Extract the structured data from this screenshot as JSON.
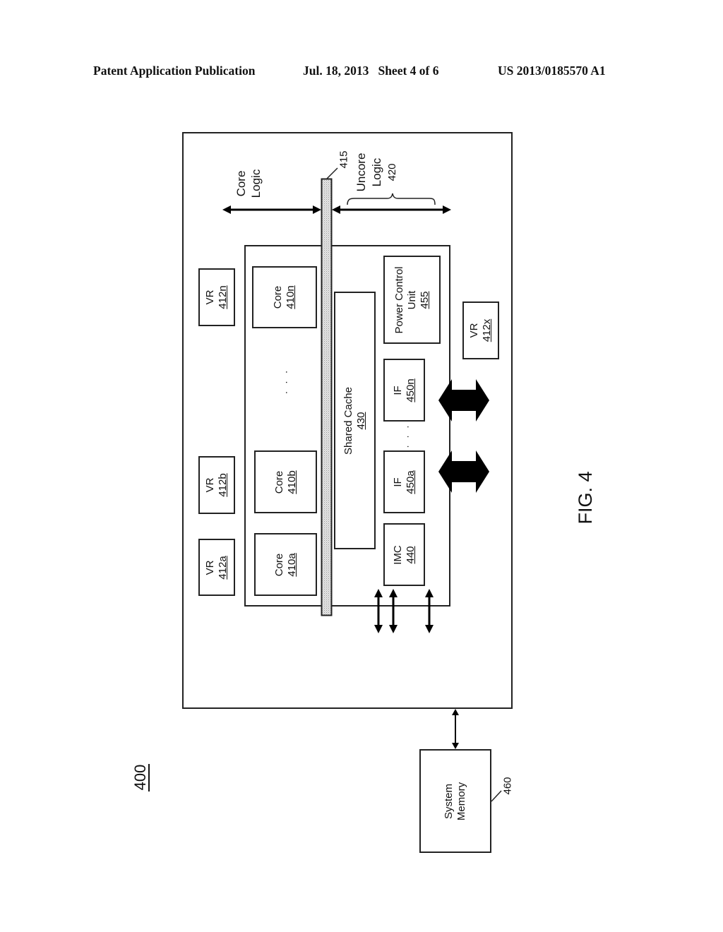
{
  "header": {
    "publication": "Patent Application Publication",
    "date_sheet": "Jul. 18, 2013   Sheet 4 of 6",
    "patent_number": "US 2013/0185570 A1"
  },
  "figure": {
    "label": "FIG. 4",
    "system_ref": "400"
  },
  "annotations": {
    "core_logic": [
      "Core",
      "Logic"
    ],
    "uncore_logic": [
      "Uncore",
      "Logic"
    ],
    "uncore_ref": "420",
    "bus_ref": "415",
    "ellipsis": "· · ·"
  },
  "voltage_regulators": [
    {
      "label": "VR",
      "ref": "412n"
    },
    {
      "label": "VR",
      "ref": "412b"
    },
    {
      "label": "VR",
      "ref": "412a"
    },
    {
      "label": "VR",
      "ref": "412x"
    }
  ],
  "cores": [
    {
      "label": "Core",
      "ref": "410n"
    },
    {
      "label": "Core",
      "ref": "410b"
    },
    {
      "label": "Core",
      "ref": "410a"
    }
  ],
  "shared_cache": {
    "label": "Shared Cache",
    "ref": "430"
  },
  "power_control_unit": {
    "label_line1": "Power Control",
    "label_line2": "Unit",
    "ref": "455"
  },
  "interfaces": [
    {
      "label": "IF",
      "ref": "450n"
    },
    {
      "label": "IF",
      "ref": "450a"
    }
  ],
  "imc": {
    "label": "IMC",
    "ref": "440"
  },
  "system_memory": {
    "label_line1": "System",
    "label_line2": "Memory",
    "ref": "460"
  }
}
